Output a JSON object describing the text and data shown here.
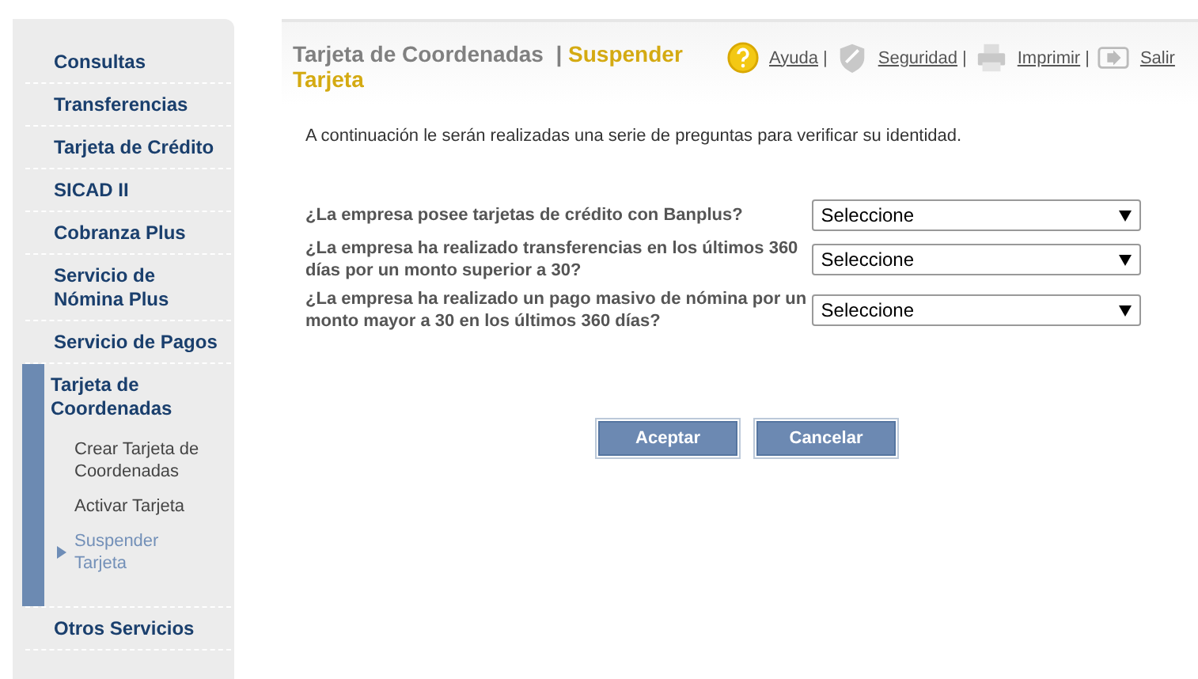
{
  "sidebar": {
    "items": [
      {
        "label": "Consultas",
        "expanded": false
      },
      {
        "label": "Transferencias",
        "expanded": false
      },
      {
        "label": "Tarjeta de Crédito",
        "expanded": false
      },
      {
        "label": "SICAD II",
        "expanded": false
      },
      {
        "label": "Cobranza Plus",
        "expanded": false
      },
      {
        "label": "Servicio de Nómina Plus",
        "expanded": false
      },
      {
        "label": "Servicio de Pagos",
        "expanded": false
      },
      {
        "label": "Tarjeta de Coordenadas",
        "expanded": true,
        "children": [
          {
            "label": "Crear Tarjeta de Coordenadas",
            "selected": false
          },
          {
            "label": "Activar Tarjeta",
            "selected": false
          },
          {
            "label": "Suspender Tarjeta",
            "selected": true
          }
        ]
      },
      {
        "label": "Otros Servicios",
        "expanded": false
      }
    ]
  },
  "header": {
    "title": "Tarjeta de Coordenadas",
    "separator": "|",
    "subtitle": "Suspender Tarjeta",
    "links": [
      {
        "kind": "help",
        "label": "Ayuda",
        "separator": "|"
      },
      {
        "kind": "security",
        "label": "Seguridad",
        "separator": "|"
      },
      {
        "kind": "print",
        "label": "Imprimir",
        "separator": "|"
      },
      {
        "kind": "exit",
        "label": "Salir"
      }
    ]
  },
  "intro": "A continuación le serán realizadas una serie de preguntas para verificar su identidad.",
  "questions": [
    {
      "label": "¿La empresa posee tarjetas de crédito con Banplus?",
      "value": "Seleccione"
    },
    {
      "label": "¿La empresa ha realizado transferencias en los últimos 360 días por un monto superior a 30?",
      "value": "Seleccione"
    },
    {
      "label": "¿La empresa ha realizado un pago masivo de nómina por un monto mayor a 30 en los últimos 360 días?",
      "value": "Seleccione"
    }
  ],
  "buttons": [
    "Aceptar",
    "Cancelar"
  ]
}
